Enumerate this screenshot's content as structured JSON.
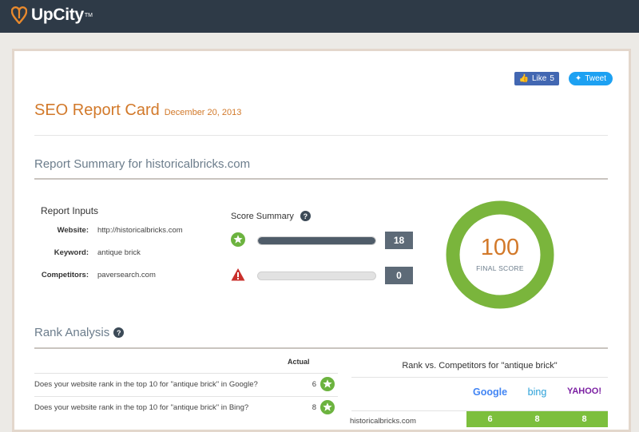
{
  "brand": {
    "name": "UpCity",
    "tm": "TM",
    "accent": "#d2792a",
    "header_bg": "#2e3a47"
  },
  "social": {
    "like_label": "Like",
    "like_count": "5",
    "tweet_label": "Tweet"
  },
  "report": {
    "title": "SEO Report Card",
    "date": "December 20, 2013"
  },
  "summary": {
    "heading": "Report Summary for historicalbricks.com",
    "inputs_heading": "Report Inputs",
    "inputs": [
      {
        "label": "Website:",
        "value": "http://historicalbricks.com"
      },
      {
        "label": "Keyword:",
        "value": "antique brick"
      },
      {
        "label": "Competitors:",
        "value": "paversearch.com"
      }
    ],
    "score_heading": "Score Summary",
    "bars": [
      {
        "icon": "green-star-icon",
        "count": "18",
        "fill": 1.0
      },
      {
        "icon": "red-warning-icon",
        "count": "0",
        "fill": 0.0
      }
    ],
    "final_score": "100",
    "final_label": "FINAL SCORE",
    "score_fraction": 1.0,
    "donut_color": "#7ab53c"
  },
  "rank": {
    "heading": "Rank Analysis",
    "actual_label": "Actual",
    "questions": [
      {
        "text": "Does your website rank in the top 10 for \"antique brick\" in Google?",
        "value": "6"
      },
      {
        "text": "Does your website rank in the top 10 for \"antique brick\" in Bing?",
        "value": "8"
      }
    ],
    "competitors_heading": "Rank vs. Competitors for \"antique brick\"",
    "engines": [
      "Google",
      "bing",
      "YAHOO!"
    ],
    "site": "historicalbricks.com",
    "site_ranks": [
      "6",
      "8",
      "8"
    ]
  }
}
